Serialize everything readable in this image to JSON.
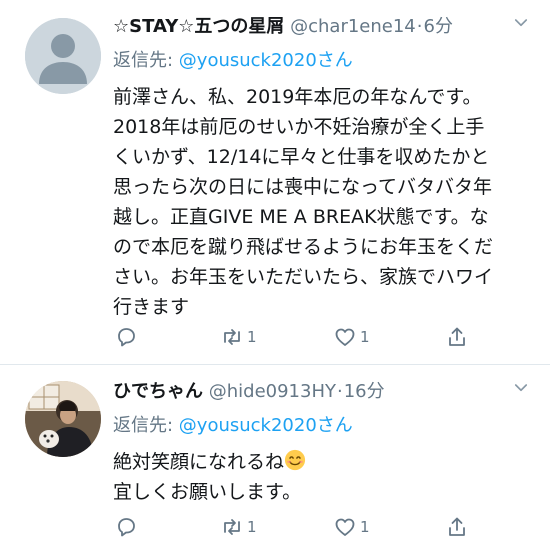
{
  "tweets": [
    {
      "name": "☆STAY☆五つの星屑",
      "handle": "@char1ene14",
      "time": "6分",
      "reply_prefix": "返信先: ",
      "reply_to": "@yousuck2020さん",
      "lines": [
        "前澤さん、私、2019年本厄の年なんです。",
        "2018年は前厄のせいか不妊治療が全く上手",
        "くいかず、12/14に早々と仕事を収めたかと",
        "思ったら次の日には喪中になってバタバタ年",
        "越し。正直GIVE ME A BREAK状態です。な",
        "ので本厄を蹴り飛ばせるようにお年玉をくだ",
        "さい。お年玉をいただいたら、家族でハワイ",
        "行きます"
      ],
      "retweets": "1",
      "likes": "1"
    },
    {
      "name": "ひでちゃん",
      "handle": "@hide0913HY",
      "time": "16分",
      "reply_prefix": "返信先: ",
      "reply_to": "@yousuck2020さん",
      "line1": "絶対笑顔になれるね",
      "line2": "宜しくお願いします。",
      "retweets": "1",
      "likes": "1"
    }
  ],
  "icons": {
    "reply": "reply-icon",
    "retweet": "retweet-icon",
    "like": "heart-icon",
    "share": "share-icon",
    "caret": "chevron-down-icon",
    "emoji": "smiling-face-emoji"
  },
  "colors": {
    "link": "#1da1f2",
    "secondary": "#657786",
    "divider": "#e1e8ed"
  }
}
